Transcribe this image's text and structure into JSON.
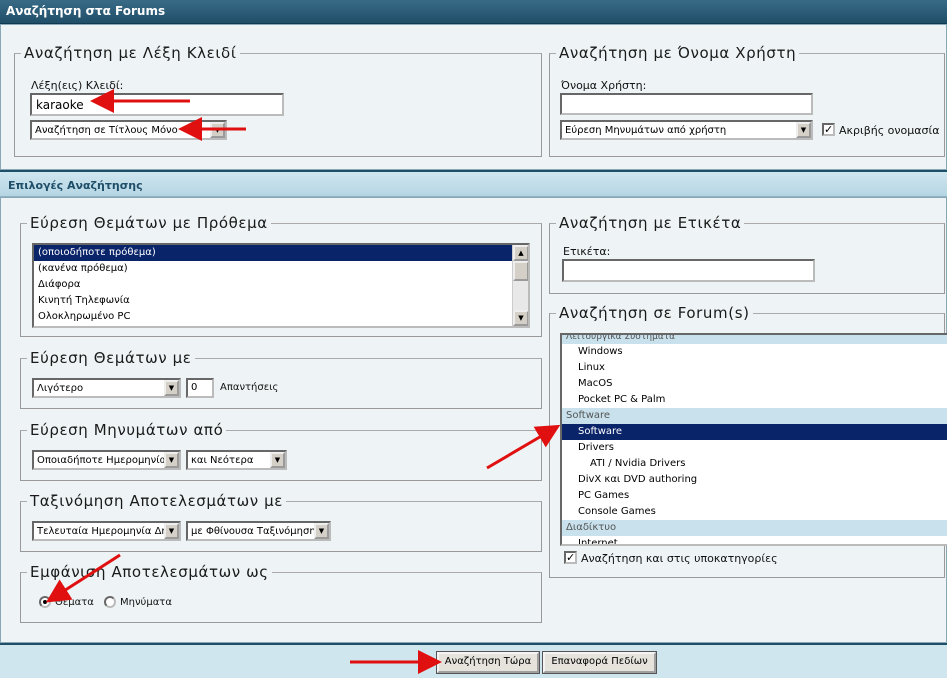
{
  "window": {
    "title": "Αναζήτηση στα Forums"
  },
  "keyword_search": {
    "legend": "Αναζήτηση με Λέξη Κλειδί",
    "label": "Λέξη(εις) Κλειδί:",
    "value": "karaoke",
    "mode_selected": "Αναζήτηση σε Τίτλους Μόνο"
  },
  "username_search": {
    "legend": "Αναζήτηση με Όνομα Χρήστη",
    "label": "Όνομα Χρήστη:",
    "value": "",
    "mode_selected": "Εύρεση Μηνυμάτων από χρήστη",
    "exact_label": "Ακριβής ονομασία",
    "exact_checked": true
  },
  "options_header": "Επιλογές Αναζήτησης",
  "prefix": {
    "legend": "Εύρεση Θεμάτων με Πρόθεμα",
    "items": [
      {
        "label": "(οποιοδήποτε πρόθεμα)",
        "selected": true
      },
      {
        "label": "(κανένα πρόθεμα)",
        "selected": false
      },
      {
        "label": "Διάφορα",
        "selected": false
      },
      {
        "label": "Κινητή Τηλεφωνία",
        "selected": false
      },
      {
        "label": "Ολοκληρωμένο PC",
        "selected": false
      }
    ]
  },
  "replies": {
    "legend": "Εύρεση Θεμάτων με",
    "comparison": "Λιγότερο",
    "count": "0",
    "unit": "Απαντήσεις"
  },
  "posts_from": {
    "legend": "Εύρεση Μηνυμάτων από",
    "date": "Οποιαδήποτε Ημερομηνία",
    "direction": "και Νεότερα"
  },
  "sort": {
    "legend": "Ταξινόμηση Αποτελεσμάτων με",
    "by": "Τελευταία Ημερομηνία Δημ",
    "order": "με Φθίνουσα Ταξινόμηση"
  },
  "show_as": {
    "legend": "Εμφάνιση Αποτελεσμάτων ως",
    "options": [
      "Θέματα",
      "Μηνύματα"
    ],
    "selected": "Θέματα"
  },
  "tag_search": {
    "legend": "Αναζήτηση με Ετικέτα",
    "label": "Ετικέτα:",
    "value": ""
  },
  "forum_search": {
    "legend": "Αναζήτηση σε Forum(s)",
    "top_clipped": "Λειτουργικά Συστήματα",
    "rows": [
      {
        "label": "Windows",
        "kind": "child"
      },
      {
        "label": "Linux",
        "kind": "child"
      },
      {
        "label": "MacOS",
        "kind": "child"
      },
      {
        "label": "Pocket PC & Palm",
        "kind": "child"
      },
      {
        "label": "Software",
        "kind": "group"
      },
      {
        "label": "Software",
        "kind": "sel"
      },
      {
        "label": "Drivers",
        "kind": "child"
      },
      {
        "label": "ATI / Nvidia Drivers",
        "kind": "grand"
      },
      {
        "label": "DivX και DVD authoring",
        "kind": "child"
      },
      {
        "label": "PC Games",
        "kind": "child"
      },
      {
        "label": "Console Games",
        "kind": "child"
      },
      {
        "label": "Διαδίκτυο",
        "kind": "group"
      },
      {
        "label": "Internet",
        "kind": "child"
      }
    ],
    "subcats_label": "Αναζήτηση και στις υποκατηγορίες",
    "subcats_checked": true
  },
  "buttons": {
    "search_now": "Αναζήτηση Τώρα",
    "reset": "Επαναφορά Πεδίων"
  },
  "colors": {
    "annotation_arrow": "#e01010",
    "header_dark": "#1e4e68"
  }
}
